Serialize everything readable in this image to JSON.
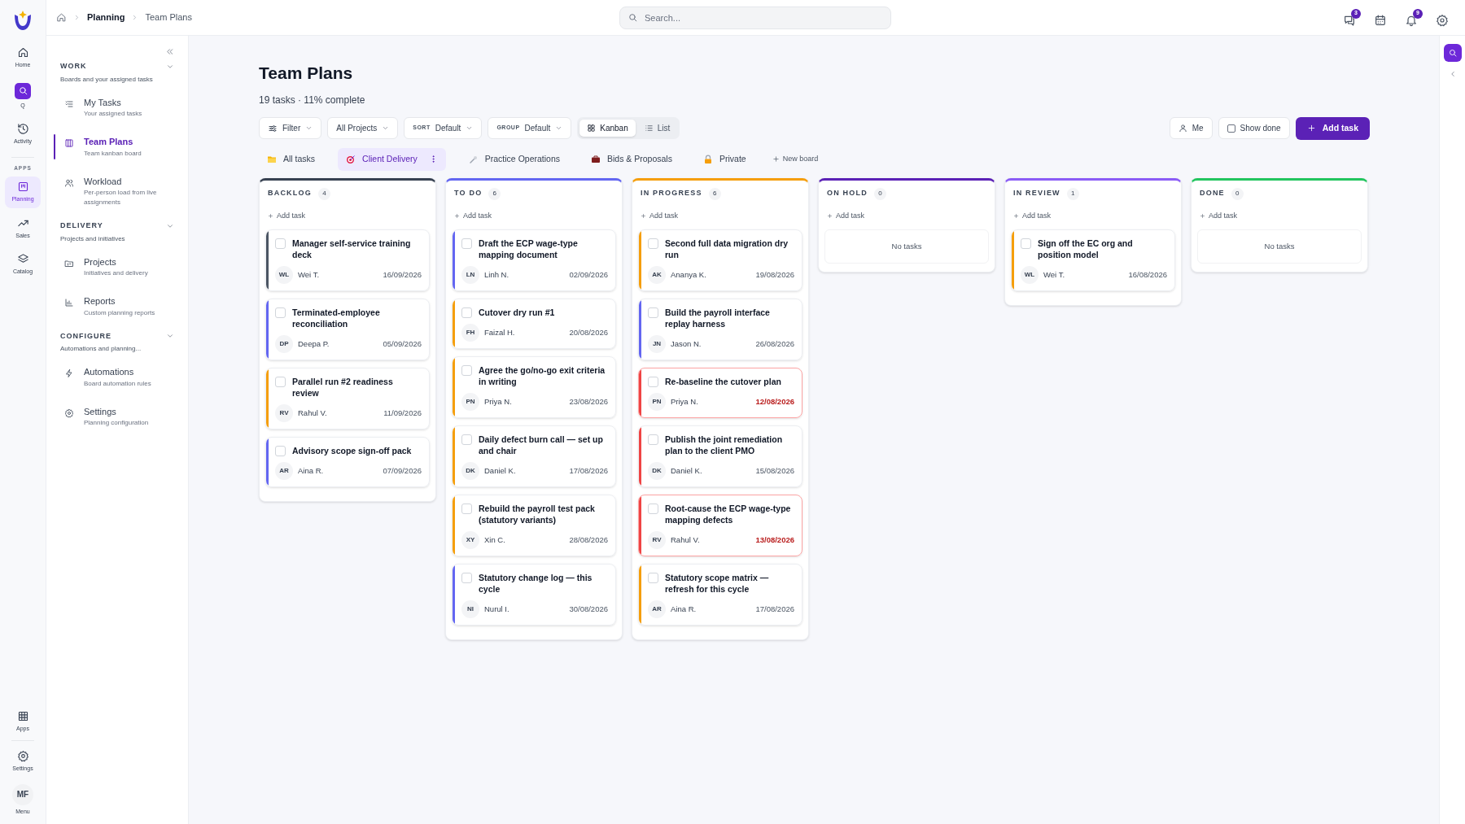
{
  "breadcrumb": [
    {
      "label": "Planning",
      "current": false
    },
    {
      "label": "Team Plans",
      "current": true
    }
  ],
  "search": {
    "placeholder": "Search..."
  },
  "header_badges": {
    "messages": "3",
    "notifications": "9"
  },
  "rail": {
    "top": [
      {
        "label": "Home",
        "selected": false
      },
      {
        "label": "Q",
        "selected": false
      },
      {
        "label": "Activity",
        "selected": false
      }
    ],
    "section": "APPS",
    "apps": [
      {
        "label": "Planning",
        "selected": true
      },
      {
        "label": "Sales",
        "selected": false
      },
      {
        "label": "Catalog",
        "selected": false
      }
    ],
    "bottom": [
      {
        "label": "Apps"
      },
      {
        "label": "Settings"
      }
    ],
    "user": {
      "initials": "MF",
      "label": "Menu"
    }
  },
  "sidebar": {
    "sections": [
      {
        "title": "WORK",
        "subtitle": "Boards and your assigned tasks",
        "expanded": true,
        "items": [
          {
            "label": "My Tasks",
            "description": "Your assigned tasks",
            "selected": false
          },
          {
            "label": "Team Plans",
            "description": "Team kanban board",
            "selected": true
          },
          {
            "label": "Workload",
            "description": "Per-person load from live assignments",
            "selected": false
          }
        ]
      },
      {
        "title": "DELIVERY",
        "subtitle": "Projects and initiatives",
        "expanded": true,
        "items": [
          {
            "label": "Projects",
            "description": "Initiatives and delivery",
            "selected": false
          },
          {
            "label": "Reports",
            "description": "Custom planning reports",
            "selected": false
          }
        ]
      },
      {
        "title": "CONFIGURE",
        "subtitle": "Automations and planning...",
        "expanded": true,
        "items": [
          {
            "label": "Automations",
            "description": "Board automation rules",
            "selected": false
          },
          {
            "label": "Settings",
            "description": "Planning configuration",
            "selected": false
          }
        ]
      }
    ]
  },
  "page": {
    "title": "Team Plans",
    "summary": "19 tasks · 11% complete"
  },
  "toolbar": {
    "filter": "Filter",
    "projects": "All Projects",
    "sort": {
      "label": "SORT",
      "value": "Default"
    },
    "group": {
      "label": "GROUP",
      "value": "Default"
    },
    "views": [
      {
        "label": "Kanban",
        "selected": true
      },
      {
        "label": "List",
        "selected": false
      }
    ],
    "me": "Me",
    "show_done": {
      "label": "Show done",
      "checked": false
    },
    "add_task": "Add task"
  },
  "boards": [
    {
      "label": "All tasks",
      "selected": false
    },
    {
      "label": "Client Delivery",
      "selected": true
    },
    {
      "label": "Practice Operations",
      "selected": false
    },
    {
      "label": "Bids & Proposals",
      "selected": false
    },
    {
      "label": "Private",
      "selected": false
    }
  ],
  "new_board": "New board",
  "columns": [
    {
      "title": "BACKLOG",
      "count": "4",
      "color": "#374151",
      "add_label": "Add task",
      "cards": [
        {
          "title": "Manager self-service training deck",
          "initials": "WL",
          "assignee": "Wei T.",
          "due": "16/09/2026",
          "color": "#4b5563",
          "overdue": false,
          "checked": false
        },
        {
          "title": "Terminated-employee reconciliation",
          "initials": "DP",
          "assignee": "Deepa P.",
          "due": "05/09/2026",
          "color": "#6366f1",
          "overdue": false,
          "checked": false
        },
        {
          "title": "Parallel run #2 readiness review",
          "initials": "RV",
          "assignee": "Rahul V.",
          "due": "11/09/2026",
          "color": "#f59e0b",
          "overdue": false,
          "checked": false
        },
        {
          "title": "Advisory scope sign-off pack",
          "initials": "AR",
          "assignee": "Aina R.",
          "due": "07/09/2026",
          "color": "#6366f1",
          "overdue": false,
          "checked": false
        }
      ]
    },
    {
      "title": "TO DO",
      "count": "6",
      "color": "#6366f1",
      "add_label": "Add task",
      "cards": [
        {
          "title": "Draft the ECP wage-type mapping document",
          "initials": "LN",
          "assignee": "Linh N.",
          "due": "02/09/2026",
          "color": "#6366f1",
          "overdue": false,
          "checked": false
        },
        {
          "title": "Cutover dry run #1",
          "initials": "FH",
          "assignee": "Faizal H.",
          "due": "20/08/2026",
          "color": "#f59e0b",
          "overdue": false,
          "checked": false
        },
        {
          "title": "Agree the go/no-go exit criteria in writing",
          "initials": "PN",
          "assignee": "Priya N.",
          "due": "23/08/2026",
          "color": "#f59e0b",
          "overdue": false,
          "checked": false
        },
        {
          "title": "Daily defect burn call — set up and chair",
          "initials": "DK",
          "assignee": "Daniel K.",
          "due": "17/08/2026",
          "color": "#f59e0b",
          "overdue": false,
          "checked": false
        },
        {
          "title": "Rebuild the payroll test pack (statutory variants)",
          "initials": "XY",
          "assignee": "Xin C.",
          "due": "28/08/2026",
          "color": "#f59e0b",
          "overdue": false,
          "checked": false
        },
        {
          "title": "Statutory change log — this cycle",
          "initials": "NI",
          "assignee": "Nurul I.",
          "due": "30/08/2026",
          "color": "#6366f1",
          "overdue": false,
          "checked": false
        }
      ]
    },
    {
      "title": "IN PROGRESS",
      "count": "6",
      "color": "#f59e0b",
      "add_label": "Add task",
      "cards": [
        {
          "title": "Second full data migration dry run",
          "initials": "AK",
          "assignee": "Ananya K.",
          "due": "19/08/2026",
          "color": "#f59e0b",
          "overdue": false,
          "checked": false
        },
        {
          "title": "Build the payroll interface replay harness",
          "initials": "JN",
          "assignee": "Jason N.",
          "due": "26/08/2026",
          "color": "#6366f1",
          "overdue": false,
          "checked": false
        },
        {
          "title": "Re-baseline the cutover plan",
          "initials": "PN",
          "assignee": "Priya N.",
          "due": "12/08/2026",
          "color": "#ef4444",
          "overdue": true,
          "checked": false
        },
        {
          "title": "Publish the joint remediation plan to the client PMO",
          "initials": "DK",
          "assignee": "Daniel K.",
          "due": "15/08/2026",
          "color": "#ef4444",
          "overdue": false,
          "checked": false
        },
        {
          "title": "Root-cause the ECP wage-type mapping defects",
          "initials": "RV",
          "assignee": "Rahul V.",
          "due": "13/08/2026",
          "color": "#ef4444",
          "overdue": true,
          "checked": false
        },
        {
          "title": "Statutory scope matrix — refresh for this cycle",
          "initials": "AR",
          "assignee": "Aina R.",
          "due": "17/08/2026",
          "color": "#f59e0b",
          "overdue": false,
          "checked": false
        }
      ]
    },
    {
      "title": "ON HOLD",
      "count": "0",
      "color": "#5b21b6",
      "add_label": "Add task",
      "empty_label": "No tasks"
    },
    {
      "title": "IN REVIEW",
      "count": "1",
      "color": "#8b5cf6",
      "add_label": "Add task",
      "cards": [
        {
          "title": "Sign off the EC org and position model",
          "initials": "WL",
          "assignee": "Wei T.",
          "due": "16/08/2026",
          "color": "#f59e0b",
          "overdue": false,
          "checked": false
        }
      ]
    },
    {
      "title": "DONE",
      "count": "0",
      "color": "#22c55e",
      "add_label": "Add task",
      "empty_label": "No tasks"
    }
  ]
}
